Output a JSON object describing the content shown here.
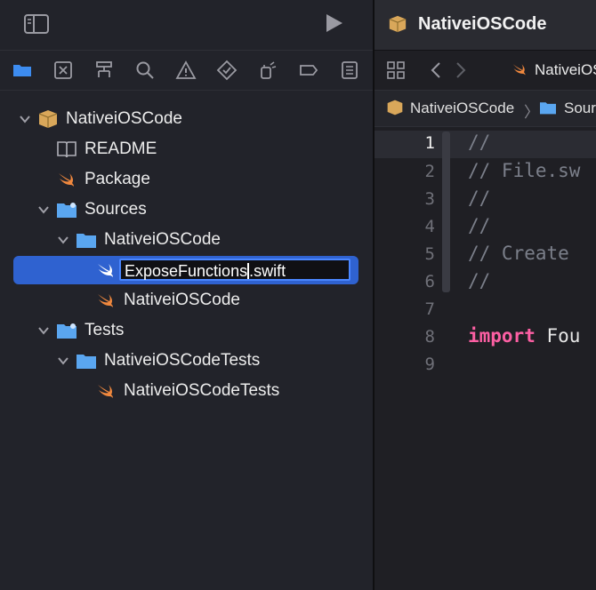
{
  "sidebar": {
    "tree": [
      {
        "label": "NativeiOSCode",
        "icon": "package-icon",
        "expanded": true
      },
      {
        "label": "README",
        "icon": "book-icon"
      },
      {
        "label": "Package",
        "icon": "swift-icon"
      },
      {
        "label": "Sources",
        "icon": "folder-icon",
        "expanded": true
      },
      {
        "label": "NativeiOSCode",
        "icon": "folder-icon",
        "expanded": true
      },
      {
        "label": "ExposeFunctions.swift",
        "icon": "swift-icon",
        "selected": true,
        "editing_before_caret": "ExposeFunctions",
        "editing_after_caret": ".swift"
      },
      {
        "label": "NativeiOSCode",
        "icon": "swift-icon"
      },
      {
        "label": "Tests",
        "icon": "folder-icon",
        "expanded": true
      },
      {
        "label": "NativeiOSCodeTests",
        "icon": "folder-icon",
        "expanded": true
      },
      {
        "label": "NativeiOSCodeTests",
        "icon": "swift-icon"
      }
    ]
  },
  "editor": {
    "window_title": "NativeiOSCode",
    "active_tab": "NativeiOSCo",
    "breadcrumb": [
      "NativeiOSCode",
      "Sour"
    ],
    "line_numbers": [
      "1",
      "2",
      "3",
      "4",
      "5",
      "6",
      "7",
      "8",
      "9"
    ],
    "lines": [
      {
        "text": "//"
      },
      {
        "text": "//  File.sw"
      },
      {
        "text": "//"
      },
      {
        "text": "//"
      },
      {
        "text": "//  Create"
      },
      {
        "text": "//"
      },
      {
        "text": ""
      },
      {
        "keyword": "import",
        "rest": " Fou"
      },
      {
        "text": ""
      }
    ]
  },
  "colors": {
    "selection": "#2f62d0",
    "folder": "#5aa6f0",
    "swift": "#f0883e",
    "keyword": "#fc5fa3"
  }
}
